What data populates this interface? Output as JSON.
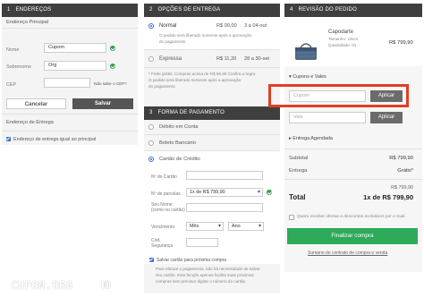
{
  "addresses": {
    "num": "1",
    "title": "ENDEREÇOS",
    "main_label": "Endereço Principal",
    "nome_label": "Nome",
    "nome_value": "Cupom",
    "sobrenome_label": "Sobrenome",
    "sobrenome_value": "Org",
    "cep_label": "CEP",
    "cep_help": "Não sabe o CEP?",
    "cancel": "Cancelar",
    "save": "Salvar",
    "delivery_label": "Endereço de Entrega",
    "same_address": "Endereço de entrega igual ao principal"
  },
  "shipping": {
    "num": "2",
    "title": "OPÇÕES DE ENTREGA",
    "options": [
      {
        "name": "Normal",
        "price": "R$ 00,00",
        "eta": "3 a 04-out",
        "desc1": "O pedido será liberado somente após a aprovação",
        "desc2": "do pagamento."
      },
      {
        "name": "Expressa",
        "price": "R$ 11,20",
        "eta": "28 a 30-set",
        "desc1": "",
        "desc2": ""
      }
    ],
    "footnote1": "* Frete grátis: Compras acima de R$ 99,90 Confira a regra",
    "footnote2": "O pedido será liberado somente após a aprovação",
    "footnote3": "do pagamento."
  },
  "payment": {
    "num": "3",
    "title": "FORMA DE PAGAMENTO",
    "methods": [
      "Débito em Conta",
      "Boleto Bancário",
      "Cartão de Crédito"
    ],
    "card_label": "Nº do Cartão",
    "installments_label": "Nº de parcelas",
    "installments_value": "1x de R$ 799,90",
    "name_label1": "Seu Nome",
    "name_label2": "(como no cartão)",
    "expiry_label": "Vencimento",
    "month": "Mês",
    "year": "Ano",
    "cvv_label1": "Cód.",
    "cvv_label2": "Segurança",
    "save_card": "Salvar cartão para próxima compra",
    "info1": "Para efetuar o pagamento, não há necessidade de salvar",
    "info2": "seu cartão. Esta função apenas facilita suas próximas",
    "info3": "compras sem precisar digitar o número do cartão."
  },
  "review": {
    "num": "4",
    "title": "REVISÃO DO PEDIDO",
    "product_name": "Capodarte",
    "product_size": "Tamanho: Único",
    "product_qty": "Quantidade: 01",
    "product_price": "R$ 799,90",
    "coupons_header": "Cupons e Vales",
    "coupon_placeholder": "Cupom",
    "apply1": "Aplicar",
    "vale_placeholder": "Vale",
    "apply2": "Aplicar",
    "scheduled": "Entrega Agendada",
    "subtotal_label": "Subtotal",
    "subtotal_value": "R$ 799,90",
    "delivery_label": "Entrega",
    "delivery_value": "Grátis*",
    "total_small": "R$ 799,90",
    "total_label": "Total",
    "total_value": "1x de R$ 799,90",
    "newsletter": "Quero receber ofertas e descontos exclusivos por e-mail",
    "finish": "Finalizar compra",
    "contract": "Sumário do contrato de compra e venda"
  },
  "watermark": "CUPOM.ORG",
  "colors": {
    "header": "#3f3f3f",
    "save": "#555555",
    "finish": "#2eaa5b",
    "apply": "#6b6b6b",
    "highlight": "#e23d25"
  }
}
